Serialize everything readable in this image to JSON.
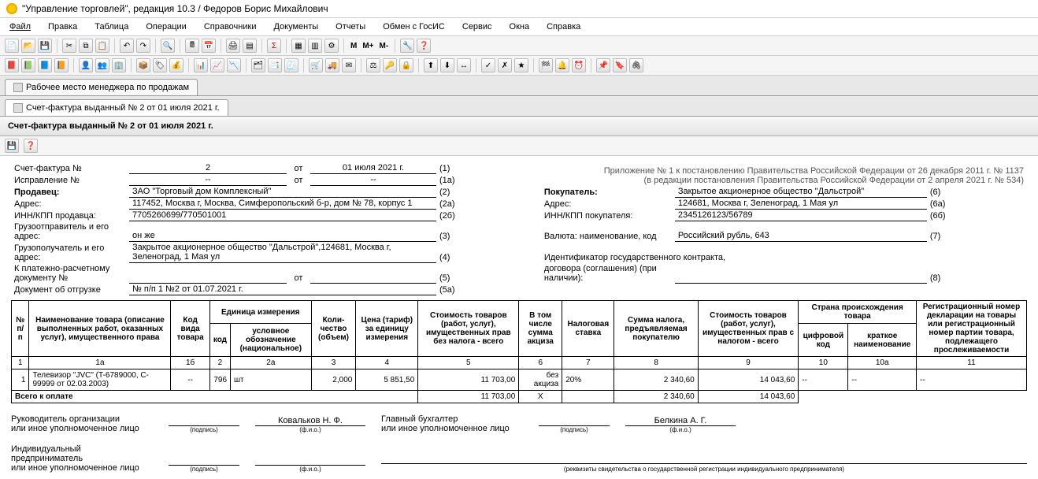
{
  "title": "\"Управление торговлей\", редакция 10.3 / Федоров Борис Михайлович",
  "menu": [
    "Файл",
    "Правка",
    "Таблица",
    "Операции",
    "Справочники",
    "Документы",
    "Отчеты",
    "Обмен с ГосИС",
    "Сервис",
    "Окна",
    "Справка"
  ],
  "toolbar_text": {
    "m": "M",
    "mp": "M+",
    "mm": "M-"
  },
  "tabs": {
    "t1": "Рабочее место менеджера по продажам",
    "t2": "Счет-фактура выданный № 2 от 01 июля 2021 г."
  },
  "doc_header": "Счет-фактура выданный № 2 от 01 июля 2021 г.",
  "appendix": {
    "l1": "Приложение № 1 к постановлению Правительства Российской Федерации от 26 декабря 2011 г. № 1137",
    "l2": "(в редакции постановления Правительства Российской Федерации от 2 апреля 2021 г. № 534)"
  },
  "hdr": {
    "invoice_no_lbl": "Счет-фактура №",
    "invoice_no": "2",
    "from_lbl": "от",
    "invoice_date": "01 июля 2021 г.",
    "ref1": "(1)",
    "corr_lbl": "Исправление №",
    "corr_no": "--",
    "corr_date": "--",
    "ref1a": "(1а)",
    "seller_lbl": "Продавец:",
    "seller": "ЗАО \"Торговый дом Комплексный\"",
    "ref2": "(2)",
    "buyer_lbl": "Покупатель:",
    "buyer": "Закрытое акционерное общество \"Дальстрой\"",
    "ref6": "(6)",
    "addr_lbl": "Адрес:",
    "seller_addr": "117452, Москва г, Москва, Симферопольский б-р, дом № 78, корпус 1",
    "ref2a": "(2а)",
    "buyer_addr": "124681, Москва г, Зеленоград, 1 Мая ул",
    "ref6a": "(6а)",
    "inn_s_lbl": "ИНН/КПП продавца:",
    "inn_s": "7705260699/770501001",
    "ref2b": "(2б)",
    "inn_b_lbl": "ИНН/КПП покупателя:",
    "inn_b": "2345126123/56789",
    "ref6b": "(6б)",
    "shipper_lbl": "Грузоотправитель и его адрес:",
    "shipper": "он же",
    "ref3": "(3)",
    "currency_lbl": "Валюта: наименование, код",
    "currency": "Российский рубль, 643",
    "ref7": "(7)",
    "consignee_lbl": "Грузополучатель и его адрес:",
    "consignee": "Закрытое акционерное общество \"Дальстрой\",124681, Москва г, Зеленоград, 1 Мая ул",
    "ref4": "(4)",
    "contract_lbl1": "Идентификатор государственного контракта,",
    "contract_lbl2": "договора (соглашения) (при наличии):",
    "ref8": "(8)",
    "payment_lbl": "К платежно-расчетному документу №",
    "payment_from": "от",
    "ref5": "(5)",
    "ship_doc_lbl": "Документ об отгрузке",
    "ship_doc": "№ п/п 1 №2 от 01.07.2021 г.",
    "ref5a": "(5а)"
  },
  "cols": {
    "c1": "№ п/п",
    "c1a": "Наименование товара (описание выполненных работ, оказанных услуг), имущественного права",
    "c1b": "Код вида товара",
    "unit": "Единица измерения",
    "c2": "код",
    "c2a": "условное обозначение (национальное)",
    "c3": "Коли- чество (объем)",
    "c4": "Цена (тариф) за единицу измерения",
    "c5": "Стоимость товаров (работ, услуг), имущественных прав без налога - всего",
    "c6": "В том числе сумма акциза",
    "c7": "Налоговая ставка",
    "c8": "Сумма налога, предъявляемая покупателю",
    "c9": "Стоимость товаров (работ, услуг), имущественных прав с налогом - всего",
    "country": "Страна происхождения товара",
    "c10": "цифровой код",
    "c10a": "краткое наименование",
    "c11": "Регистрационный номер декларации на товары или регистрационный номер партии товара, подлежащего прослеживаемости"
  },
  "colnums": {
    "n1": "1",
    "n1a": "1а",
    "n1b": "1б",
    "n2": "2",
    "n2a": "2а",
    "n3": "3",
    "n4": "4",
    "n5": "5",
    "n6": "6",
    "n7": "7",
    "n8": "8",
    "n9": "9",
    "n10": "10",
    "n10a": "10а",
    "n11": "11"
  },
  "rows": [
    {
      "n": "1",
      "name": "Телевизор \"JVC\" (T-6789000, C-99999 от 02.03.2003)",
      "kind": "--",
      "ucode": "796",
      "uname": "шт",
      "qty": "2,000",
      "price": "5 851,50",
      "cost_net": "11 703,00",
      "excise": "без акциза",
      "rate": "20%",
      "tax": "2 340,60",
      "cost_gross": "14 043,60",
      "ccode": "--",
      "cname": "--",
      "decl": "--"
    }
  ],
  "totals": {
    "label": "Всего к оплате",
    "cost_net": "11 703,00",
    "x": "X",
    "tax": "2 340,60",
    "cost_gross": "14 043,60"
  },
  "sign": {
    "head_lbl1": "Руководитель организации",
    "head_lbl2": "или иное уполномоченное лицо",
    "head_name": "Ковальков Н. Ф.",
    "acct_lbl1": "Главный бухгалтер",
    "acct_lbl2": "или иное уполномоченное лицо",
    "acct_name": "Белкина А. Г.",
    "ip_lbl1": "Индивидуальный предприниматель",
    "ip_lbl2": "или иное уполномоченное лицо",
    "sub_sign": "(подпись)",
    "sub_fio": "(ф.и.о.)",
    "sub_rekv": "(реквизиты свидетельства о государственной регистрации индивидуального предпринимателя)"
  }
}
